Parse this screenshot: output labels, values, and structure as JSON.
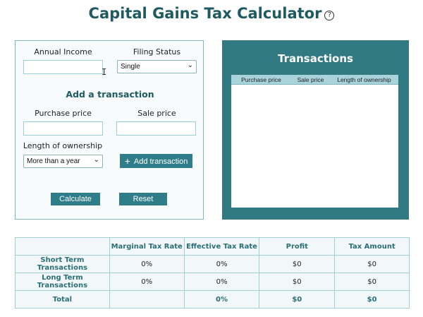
{
  "header": {
    "title": "Capital Gains Tax Calculator",
    "help_glyph": "?"
  },
  "form": {
    "annual_income_label": "Annual Income",
    "annual_income_value": "",
    "filing_status_label": "Filing Status",
    "filing_status_value": "Single",
    "add_transaction_heading": "Add a transaction",
    "purchase_price_label": "Purchase price",
    "purchase_price_value": "",
    "sale_price_label": "Sale price",
    "sale_price_value": "",
    "length_label": "Length of ownership",
    "length_value": "More than a year",
    "add_button": "Add transaction",
    "calculate_button": "Calculate",
    "reset_button": "Reset"
  },
  "transactions": {
    "title": "Transactions",
    "columns": [
      "Purchase price",
      "Sale price",
      "Length of ownership"
    ]
  },
  "results": {
    "headers": [
      "",
      "Marginal Tax Rate",
      "Effective Tax Rate",
      "Profit",
      "Tax Amount"
    ],
    "rows": [
      [
        "Short Term Transactions",
        "0%",
        "0%",
        "$0",
        "$0"
      ],
      [
        "Long Term Transactions",
        "0%",
        "0%",
        "$0",
        "$0"
      ],
      [
        "Total",
        "",
        "0%",
        "$0",
        "$0"
      ]
    ]
  },
  "colors": {
    "accent": "#2f7d88",
    "panel": "#317a84",
    "heading": "#1f5a60"
  }
}
